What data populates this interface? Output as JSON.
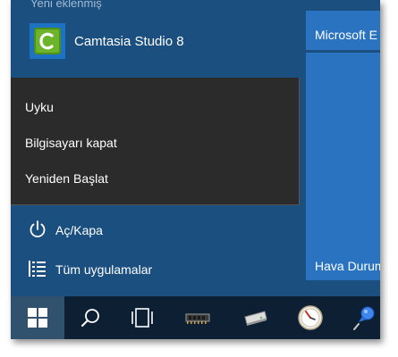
{
  "start_menu": {
    "section_header": "Yeni eklenmiş",
    "recent_app": {
      "label": "Camtasia Studio 8",
      "icon": "camtasia-icon"
    },
    "power_flyout": {
      "items": [
        {
          "label": "Uyku"
        },
        {
          "label": "Bilgisayarı kapat"
        },
        {
          "label": "Yeniden Başlat"
        }
      ]
    },
    "power_button": {
      "label": "Aç/Kapa",
      "icon": "power-icon"
    },
    "all_apps_button": {
      "label": "Tüm uygulamalar",
      "icon": "list-icon"
    },
    "tiles": {
      "microsoft_edge": {
        "label": "Microsoft E"
      },
      "weather": {
        "label": "Hava Durum"
      }
    }
  },
  "taskbar": {
    "items": [
      {
        "name": "start",
        "icon": "windows-logo-icon"
      },
      {
        "name": "search",
        "icon": "search-icon"
      },
      {
        "name": "task-view",
        "icon": "task-view-icon"
      },
      {
        "name": "chip-app",
        "icon": "memory-chip-icon"
      },
      {
        "name": "drive-app",
        "icon": "hard-drive-icon"
      },
      {
        "name": "clock-app",
        "icon": "clock-icon"
      },
      {
        "name": "pin-app",
        "icon": "pushpin-icon"
      }
    ]
  },
  "colors": {
    "menu_background": "#1b4f7f",
    "tile_blue": "#2a73c0",
    "flyout_background": "#2b2b2b",
    "taskbar_background": "#0d1f33",
    "start_button_active": "#30526f"
  }
}
